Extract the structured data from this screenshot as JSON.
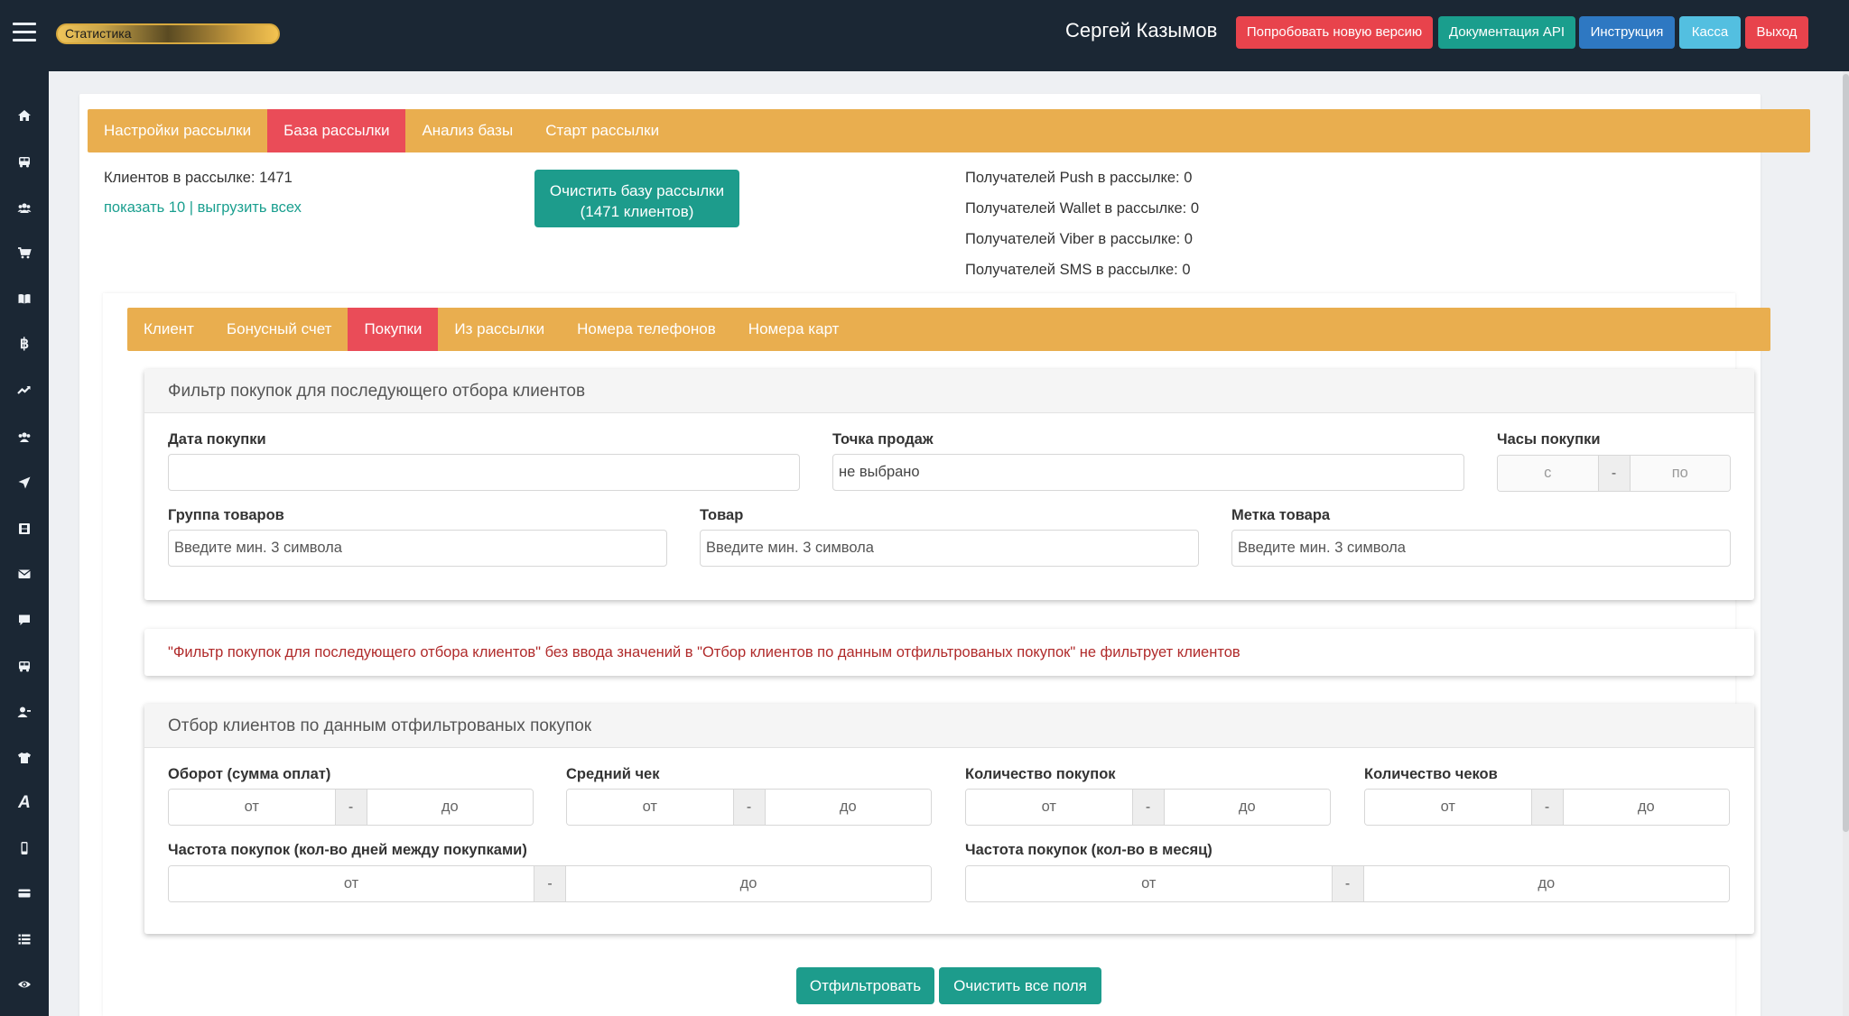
{
  "header": {
    "stat_label": "Статистика",
    "user_name": "Сергей Казымов",
    "buttons": {
      "try_new": "Попробовать новую версию",
      "api_docs": "Документация API",
      "instruction": "Инструкция",
      "kassa": "Касса",
      "logout": "Выход"
    },
    "colors": {
      "red": "#e8434c",
      "teal": "#1a9e8d",
      "blue": "#2e78c2",
      "cyan": "#53bfe0",
      "dark": "#1b2734",
      "tab_orange": "#e9ae4f",
      "tab_active": "#ea4c58"
    }
  },
  "sidebar": {
    "icons": [
      "home-icon",
      "bus-icon",
      "users-icon",
      "cart-icon",
      "book-icon",
      "bitcoin-icon",
      "chart-line-icon",
      "group-icon",
      "send-icon",
      "film-icon",
      "envelope-icon",
      "comment-icon",
      "bus-icon",
      "user-icon",
      "shirt-icon",
      "font-icon",
      "mobile-icon",
      "credit-card-icon",
      "list-icon",
      "eye-icon"
    ]
  },
  "main_tabs": [
    "Настройки рассылки",
    "База рассылки",
    "Анализ базы",
    "Старт рассылки"
  ],
  "info": {
    "clients_count": "Клиентов в рассылке: 1471",
    "show_10": "показать 10",
    "separator": " | ",
    "export_all": "выгрузить всех",
    "clear_base_line1": "Очистить базу рассылки",
    "clear_base_line2": "(1471 клиентов)",
    "push": "Получателей Push в рассылке: 0",
    "wallet": "Получателей Wallet в рассылке: 0",
    "viber": "Получателей Viber в рассылке: 0",
    "sms": "Получателей SMS в рассылке: 0"
  },
  "sub_tabs": [
    "Клиент",
    "Бонусный счет",
    "Покупки",
    "Из рассылки",
    "Номера телефонов",
    "Номера карт"
  ],
  "filter_panel": {
    "title": "Фильтр покупок для последующего отбора клиентов",
    "purchase_date_label": "Дата покупки",
    "purchase_date_value": "",
    "sale_point_label": "Точка продаж",
    "sale_point_value": "не выбрано",
    "hours_label": "Часы покупки",
    "hours_from": "с",
    "hours_dash": "-",
    "hours_to": "по",
    "group_label": "Группа товаров",
    "product_label": "Товар",
    "tag_label": "Метка товара",
    "min3_placeholder": "Введите мин. 3 символа"
  },
  "note": "\"Фильтр покупок для последующего отбора клиентов\" без ввода значений в \"Отбор клиентов по данным отфильтрованых покупок\" не фильтрует клиентов",
  "selection_panel": {
    "title": "Отбор клиентов по данным отфильтрованых покупок",
    "turnover_label": "Оборот (сумма оплат)",
    "avg_check_label": "Средний чек",
    "purchases_count_label": "Количество покупок",
    "checks_count_label": "Количество чеков",
    "freq_days_label": "Частота покупок (кол-во дней между покупками)",
    "freq_month_label": "Частота покупок (кол-во в месяц)",
    "from": "от",
    "dash": "-",
    "to": "до"
  },
  "actions": {
    "filter": "Отфильтровать",
    "clear_all": "Очистить все поля"
  }
}
